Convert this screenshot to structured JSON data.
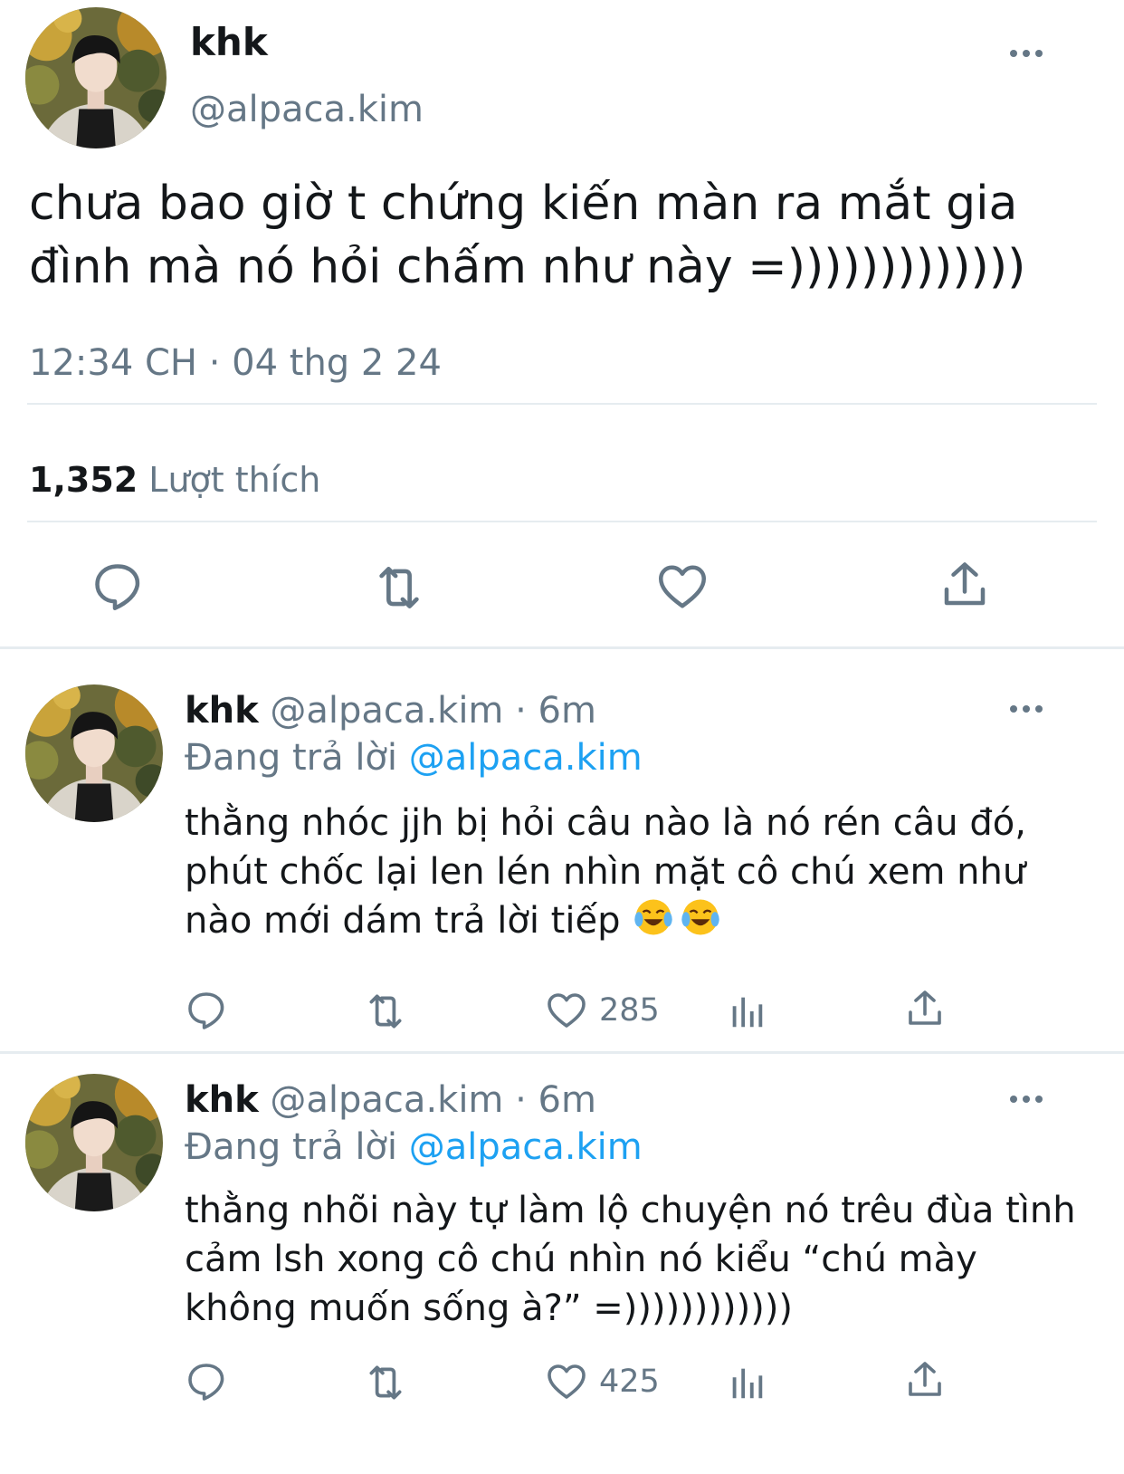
{
  "main_tweet": {
    "name": "khk",
    "handle": "@alpaca.kim",
    "text": "chưa bao giờ t chứng kiến màn ra mắt gia đình mà nó hỏi chấm như này =)))))))))))))",
    "timestamp": "12:34 CH · 04 thg 2 24",
    "likes_count": "1,352",
    "likes_label": "Lượt thích"
  },
  "replies": [
    {
      "name": "khk",
      "meta": "@alpaca.kim · 6m",
      "replying_prefix": "Đang trả lời ",
      "replying_to": "@alpaca.kim",
      "text": "thằng nhóc jjh bị hỏi câu nào là nó rén câu đó, phút chốc lại len lén nhìn mặt cô chú xem như nào mới dám trả lời tiếp",
      "emojis": [
        "face-with-tears-of-joy",
        "face-with-tears-of-joy"
      ],
      "likes": "285"
    },
    {
      "name": "khk",
      "meta": "@alpaca.kim · 6m",
      "replying_prefix": "Đang trả lời ",
      "replying_to": "@alpaca.kim",
      "text": "thằng nhõi này tự làm lộ chuyện nó trêu đùa tình cảm lsh xong cô chú nhìn nó kiểu “chú mày không muốn sống à?” =))))))))))))",
      "likes": "425"
    }
  ],
  "icons": [
    "reply-icon",
    "retweet-icon",
    "like-icon",
    "share-icon",
    "analytics-icon",
    "more-icon"
  ],
  "colors": {
    "text": "#14171a",
    "secondary": "#657786",
    "link": "#1da1f2",
    "divider": "#e6ecf0"
  }
}
